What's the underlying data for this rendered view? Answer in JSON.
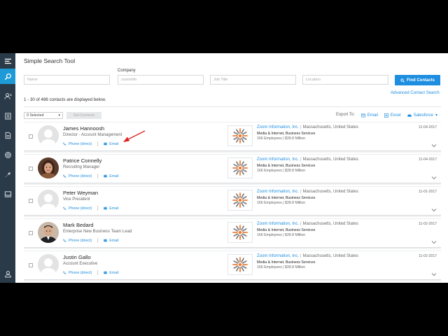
{
  "app": {
    "title": "Simple Search Tool"
  },
  "sidebar": {
    "items": [
      {
        "icon": "menu-icon"
      },
      {
        "icon": "search-icon",
        "active": true
      },
      {
        "icon": "contacts-icon"
      },
      {
        "icon": "companies-icon"
      },
      {
        "icon": "lists-icon"
      },
      {
        "icon": "target-icon"
      },
      {
        "icon": "tools-icon"
      },
      {
        "icon": "inbox-icon"
      },
      {
        "icon": "user-icon"
      }
    ]
  },
  "search": {
    "company_label": "Company",
    "name_placeholder": "Name",
    "company_value": "zoominfo",
    "job_title_placeholder": "Job Title",
    "location_placeholder": "Location",
    "find_label": "Find Contacts",
    "advanced_label": "Advanced Contact Search"
  },
  "results": {
    "count_text": "1 - 30 of 488 contacts are displayed below.",
    "selected_label": "0 Selected",
    "get_contacts_label": "Get Contacts",
    "export_label": "Export To:",
    "export_email": "Email",
    "export_excel": "Excel",
    "export_salesforce": "Salesforce"
  },
  "contacts": [
    {
      "name": "James Hannoosh",
      "title": "Director - Account Management",
      "phone_label": "Phone (direct)",
      "email_label": "Email",
      "company": "Zoom Information, Inc.",
      "location": "Massachusetts, United States",
      "industry": "Media & Internet, Business Services",
      "employees": "166 Employees",
      "revenue": "$39.8 Million",
      "date": "11-04-2017",
      "avatar": "placeholder"
    },
    {
      "name": "Patrice Connelly",
      "title": "Recruiting Manager",
      "phone_label": "Phone (direct)",
      "email_label": "Email",
      "company": "Zoom Information, Inc.",
      "location": "Massachusetts, United States",
      "industry": "Media & Internet, Business Services",
      "employees": "166 Employees",
      "revenue": "$39.8 Million",
      "date": "11-04-2017",
      "avatar": "photo-woman"
    },
    {
      "name": "Peter Weyman",
      "title": "Vice President",
      "phone_label": "Phone (direct)",
      "email_label": "Email",
      "company": "Zoom Information, Inc.",
      "location": "Massachusetts, United States",
      "industry": "Media & Internet, Business Services",
      "employees": "166 Employees",
      "revenue": "$39.8 Million",
      "date": "11-01-2017",
      "avatar": "placeholder"
    },
    {
      "name": "Mark Bedard",
      "title": "Enterprise New Business Team Lead",
      "phone_label": "Phone (direct)",
      "email_label": "Email",
      "company": "Zoom Information, Inc.",
      "location": "Massachusetts, United States",
      "industry": "Media & Internet, Business Services",
      "employees": "166 Employees",
      "revenue": "$39.8 Million",
      "date": "11-02-2017",
      "avatar": "photo-man"
    },
    {
      "name": "Justin Gallo",
      "title": "Account Executive",
      "phone_label": "Phone (direct)",
      "email_label": "Email",
      "company": "Zoom Information, Inc.",
      "location": "Massachusetts, United States",
      "industry": "Media & Internet, Business Services",
      "employees": "166 Employees",
      "revenue": "$39.8 Million",
      "date": "11-02-2017",
      "avatar": "placeholder"
    }
  ],
  "colors": {
    "accent": "#1e8ee0",
    "sidebar": "#2b3a48",
    "sidebar_active": "#1e9ad6",
    "annotation_arrow": "#e02020",
    "logo_orange": "#f07a2e",
    "logo_gray": "#7a7f86"
  }
}
